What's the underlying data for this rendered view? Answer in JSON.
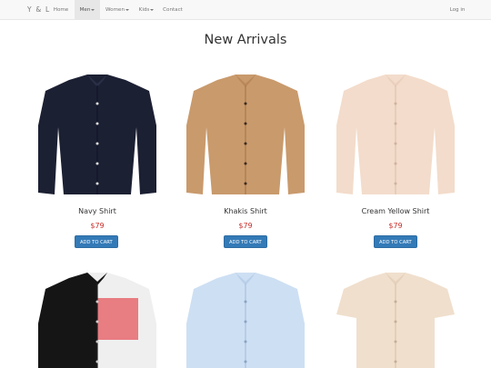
{
  "nav": {
    "brand": "Y & L",
    "items": [
      {
        "label": "Home",
        "dropdown": false,
        "active": false
      },
      {
        "label": "Men",
        "dropdown": true,
        "active": true
      },
      {
        "label": "Women",
        "dropdown": true,
        "active": false
      },
      {
        "label": "Kids",
        "dropdown": true,
        "active": false
      },
      {
        "label": "Contact",
        "dropdown": false,
        "active": false
      }
    ],
    "login": "Log in"
  },
  "page": {
    "title": "New Arrivals"
  },
  "products": [
    {
      "name": "Navy Shirt",
      "price": "$79",
      "button": "ADD TO CART",
      "color": "#1c2033"
    },
    {
      "name": "Khakis Shirt",
      "price": "$79",
      "button": "ADD TO CART",
      "color": "#c99a6c"
    },
    {
      "name": "Cream Yellow Shirt",
      "price": "$79",
      "button": "ADD TO CART",
      "color": "#f3dccb"
    },
    {
      "name": "",
      "price": "",
      "button": "",
      "color": "#efefef"
    },
    {
      "name": "",
      "price": "",
      "button": "",
      "color": "#cddff3"
    },
    {
      "name": "",
      "price": "",
      "button": "",
      "color": "#f0dfcd"
    }
  ],
  "colors": {
    "accent": "#337ab7",
    "price": "#c9302c",
    "navbar": "#f8f8f8"
  }
}
